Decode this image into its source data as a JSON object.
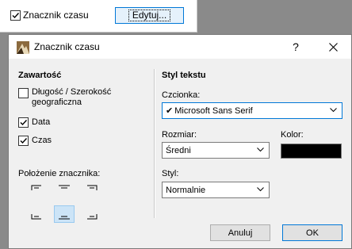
{
  "background_window": {
    "checkbox_label": "Znacznik czasu",
    "checkbox_checked": true,
    "edit_button_label": "Edytuj..."
  },
  "dialog": {
    "title": "Znacznik czasu",
    "help_label": "?",
    "content": {
      "heading": "Zawartość",
      "options": [
        {
          "label": "Długość / Szerokość geograficzna",
          "checked": false
        },
        {
          "label": "Data",
          "checked": true
        },
        {
          "label": "Czas",
          "checked": true
        }
      ]
    },
    "position": {
      "label": "Położenie znacznika:",
      "selected": "bottom-center"
    },
    "text_style": {
      "heading": "Styl tekstu",
      "font_label": "Czcionka:",
      "font_value": "Microsoft Sans Serif",
      "size_label": "Rozmiar:",
      "size_value": "Średni",
      "color_label": "Kolor:",
      "color_value": "#000000",
      "style_label": "Styl:",
      "style_value": "Normalnie"
    },
    "buttons": {
      "cancel": "Anuluj",
      "ok": "OK"
    }
  }
}
